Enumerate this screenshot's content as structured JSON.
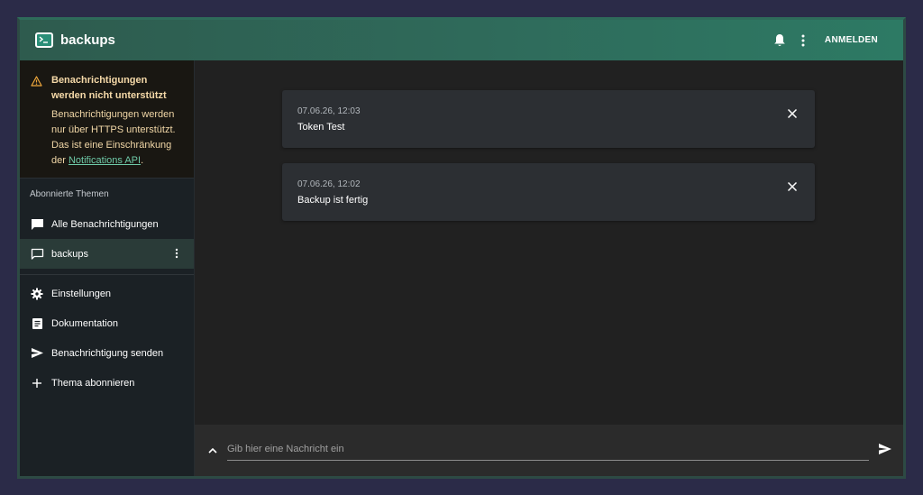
{
  "appbar": {
    "title": "backups",
    "login_label": "ANMELDEN",
    "icons": [
      "terminal-logo-icon",
      "bell-icon",
      "more-vert-icon"
    ]
  },
  "sidebar": {
    "warning": {
      "title": "Benachrichtigungen werden nicht unterstützt",
      "body_prefix": "Benachrichtigungen werden nur über HTTPS unterstützt. Das ist eine Einschränkung der ",
      "link": "Notifications API",
      "body_suffix": "."
    },
    "section_label": "Abonnierte Themen",
    "topics": [
      {
        "label": "Alle Benachrichtigungen",
        "icon": "chat-filled-icon",
        "active": false
      },
      {
        "label": "backups",
        "icon": "chat-outline-icon",
        "active": true
      }
    ],
    "menu": [
      {
        "label": "Einstellungen",
        "icon": "gear-icon"
      },
      {
        "label": "Dokumentation",
        "icon": "document-icon"
      },
      {
        "label": "Benachrichtigung senden",
        "icon": "send-icon"
      },
      {
        "label": "Thema abonnieren",
        "icon": "plus-icon"
      }
    ]
  },
  "notifications": [
    {
      "time": "07.06.26, 12:03",
      "message": "Token Test"
    },
    {
      "time": "07.06.26, 12:02",
      "message": "Backup ist fertig"
    }
  ],
  "composer": {
    "placeholder": "Gib hier eine Nachricht ein"
  },
  "colors": {
    "accent": "#2f6b5b",
    "warning_text": "#f0d6a6",
    "link": "#6fcaa8",
    "background": "#212121"
  }
}
